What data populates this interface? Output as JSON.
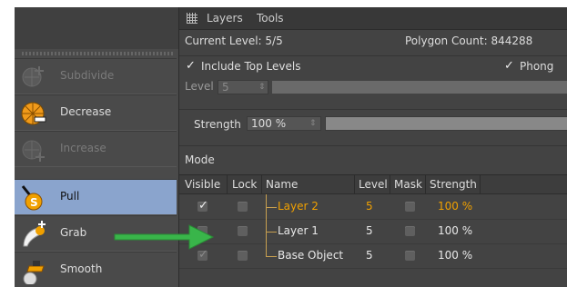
{
  "tools": [
    {
      "label": "Subdivide",
      "icon": "subdivide-icon",
      "enabled": false,
      "active": false
    },
    {
      "label": "Decrease",
      "icon": "decrease-icon",
      "enabled": true,
      "active": false
    },
    {
      "label": "Increase",
      "icon": "increase-icon",
      "enabled": false,
      "active": false
    },
    {
      "label": "Pull",
      "icon": "pull-brush-icon",
      "enabled": true,
      "active": true
    },
    {
      "label": "Grab",
      "icon": "grab-brush-icon",
      "enabled": true,
      "active": false
    },
    {
      "label": "Smooth",
      "icon": "smooth-brush-icon",
      "enabled": true,
      "active": false
    }
  ],
  "header": {
    "menu": [
      "Layers",
      "Tools"
    ],
    "grid_icon": "grid-icon"
  },
  "info": {
    "current_level": "Current Level: 5/5",
    "polygon_count": "Polygon Count: 844288"
  },
  "options": {
    "include_top_levels": "Include Top Levels",
    "include_top_levels_checked": true,
    "phong": "Phong",
    "phong_checked": true,
    "level_label": "Level",
    "level_value": "5",
    "strength_label": "Strength",
    "strength_value": "100 %",
    "strength_fill": 1.0
  },
  "mode": {
    "label": "Mode"
  },
  "table": {
    "columns": [
      "Visible",
      "Lock",
      "Name",
      "Level",
      "Mask",
      "Strength"
    ],
    "rows": [
      {
        "visible": true,
        "visible_dim": false,
        "lock": false,
        "name": "Layer 2",
        "level": "5",
        "mask": false,
        "strength": "100 %",
        "highlight": true
      },
      {
        "visible": false,
        "visible_dim": false,
        "lock": false,
        "name": "Layer 1",
        "level": "5",
        "mask": false,
        "strength": "100 %",
        "highlight": false
      },
      {
        "visible": true,
        "visible_dim": true,
        "lock": false,
        "name": "Base Object",
        "level": "5",
        "mask": false,
        "strength": "100 %",
        "highlight": false
      }
    ]
  },
  "annotation": {
    "arrow_color": "#39b54a",
    "arrow_icon": "green-arrow-icon"
  },
  "colors": {
    "accent_orange": "#f0a000",
    "active_tool": "#8aa4cd"
  }
}
